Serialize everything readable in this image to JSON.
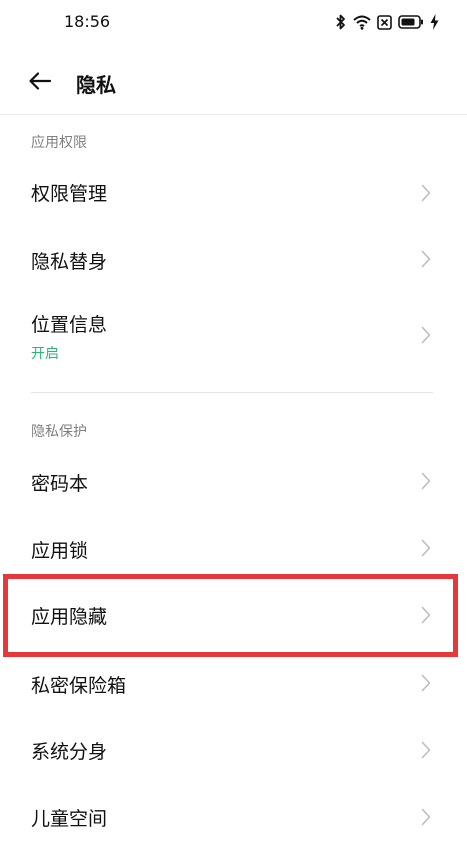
{
  "status_bar": {
    "time": "18:56",
    "icons": [
      "bluetooth-icon",
      "wifi-icon",
      "sim-off-icon",
      "battery-icon",
      "charging-icon"
    ]
  },
  "header": {
    "back_icon": "arrow-left-icon",
    "title": "隐私"
  },
  "sections": [
    {
      "header": "应用权限",
      "items": [
        {
          "label": "权限管理"
        },
        {
          "label": "隐私替身"
        },
        {
          "label": "位置信息",
          "sub": "开启"
        }
      ]
    },
    {
      "header": "隐私保护",
      "items": [
        {
          "label": "密码本"
        },
        {
          "label": "应用锁"
        },
        {
          "label": "应用隐藏"
        },
        {
          "label": "私密保险箱"
        },
        {
          "label": "系统分身"
        },
        {
          "label": "儿童空间"
        }
      ]
    }
  ],
  "colors": {
    "accent_green": "#2bb673",
    "highlight_red": "#e5383b",
    "chevron": "#bdbdbd"
  }
}
